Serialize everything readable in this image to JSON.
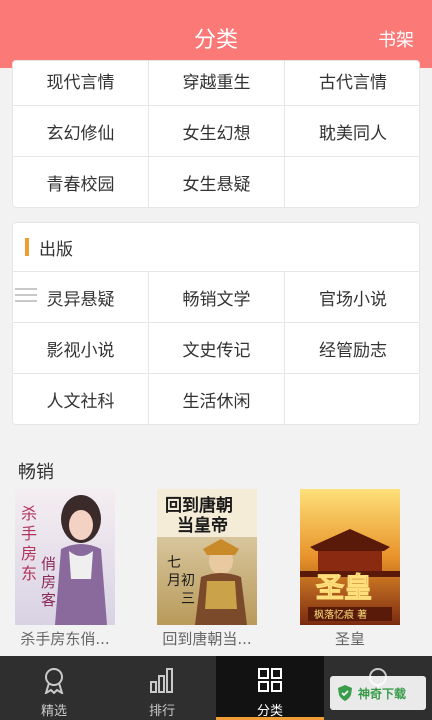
{
  "header": {
    "title": "分类",
    "shelf_label": "书架"
  },
  "category_rows": {
    "items": [
      "现代言情",
      "穿越重生",
      "古代言情",
      "玄幻修仙",
      "女生幻想",
      "耽美同人",
      "青春校园",
      "女生悬疑",
      ""
    ]
  },
  "publish": {
    "title": "出版",
    "items": [
      "灵异悬疑",
      "畅销文学",
      "官场小说",
      "影视小说",
      "文史传记",
      "经管励志",
      "人文社科",
      "生活休闲",
      ""
    ]
  },
  "hot": {
    "title": "畅销",
    "books": [
      {
        "name": "杀手房东俏...",
        "cover_text": "杀手房东俏房客"
      },
      {
        "name": "回到唐朝当...",
        "cover_text": "回到唐朝当皇帝"
      },
      {
        "name": "圣皇",
        "cover_text": "圣皇"
      }
    ]
  },
  "tabbar": {
    "tabs": [
      {
        "label": "精选",
        "icon": "ribbon-icon"
      },
      {
        "label": "排行",
        "icon": "bar-chart-icon"
      },
      {
        "label": "分类",
        "icon": "grid-icon"
      },
      {
        "label": "",
        "icon": "search-icon"
      }
    ],
    "active_index": 2
  },
  "watermark": {
    "text": "神奇下载"
  },
  "colors": {
    "header": "#fb7a78",
    "accent": "#f29c38",
    "tabbar": "#2f2f2f"
  }
}
